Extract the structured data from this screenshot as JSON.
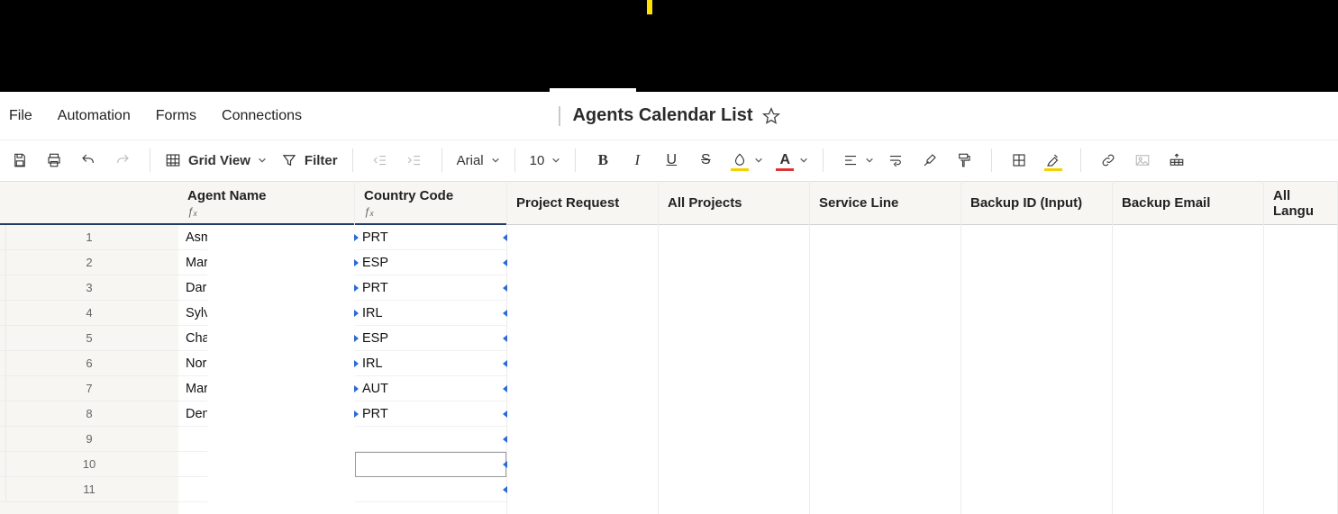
{
  "topbar": {},
  "menu": {
    "file": "File",
    "automation": "Automation",
    "forms": "Forms",
    "connections": "Connections"
  },
  "title": "Agents Calendar List",
  "toolbar": {
    "grid_view": "Grid View",
    "filter": "Filter",
    "font_name": "Arial",
    "font_size": "10"
  },
  "columns": {
    "agent_name": "Agent Name",
    "country_code": "Country Code",
    "project_request": "Project Request",
    "all_projects": "All Projects",
    "service_line": "Service Line",
    "backup_id": "Backup ID (Input)",
    "backup_email": "Backup Email",
    "all_languages": "All Langu"
  },
  "fx_label": "ƒₓ",
  "row_numbers": [
    "1",
    "2",
    "3",
    "4",
    "5",
    "6",
    "7",
    "8",
    "9",
    "10",
    "11"
  ],
  "rows": [
    {
      "agent": "Asm",
      "country": "PRT"
    },
    {
      "agent": "Mar",
      "country": "ESP"
    },
    {
      "agent": "Dar",
      "country": "PRT"
    },
    {
      "agent": "Sylv",
      "country": "IRL"
    },
    {
      "agent": "Cha",
      "country": "ESP"
    },
    {
      "agent": "Nora",
      "country": "IRL"
    },
    {
      "agent": "Mar",
      "country": "AUT"
    },
    {
      "agent": "Den",
      "country": "PRT"
    },
    {
      "agent": "",
      "country": ""
    },
    {
      "agent": "",
      "country": ""
    },
    {
      "agent": "",
      "country": ""
    }
  ],
  "colors": {
    "selection_border": "#1f3d66",
    "marker": "#2a6ad4",
    "yellow": "#f4d000",
    "red": "#d33"
  }
}
